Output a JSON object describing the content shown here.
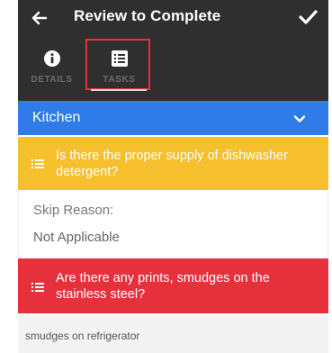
{
  "header": {
    "title": "Review to Complete",
    "back_icon": "arrow-left-icon",
    "confirm_icon": "check-icon"
  },
  "tabs": [
    {
      "label": "DETAILS",
      "icon": "info-icon"
    },
    {
      "label": "TASKS",
      "icon": "list-icon"
    }
  ],
  "section": {
    "name": "Kitchen",
    "chevron_icon": "chevron-down-icon"
  },
  "questions": [
    {
      "text": "Is there the proper supply of dishwasher detergent?",
      "status_color": "#f6bf2d",
      "answer_label": "Skip Reason:",
      "answer_value": "Not Applicable"
    },
    {
      "text": "Are there any prints, smudges on the stainless steel?",
      "status_color": "#e6313d",
      "note": "smudges on refrigerator"
    }
  ],
  "colors": {
    "header_bg": "#2f2f2f",
    "section_bg": "#2f7be8",
    "highlight_border": "#e0313c"
  }
}
